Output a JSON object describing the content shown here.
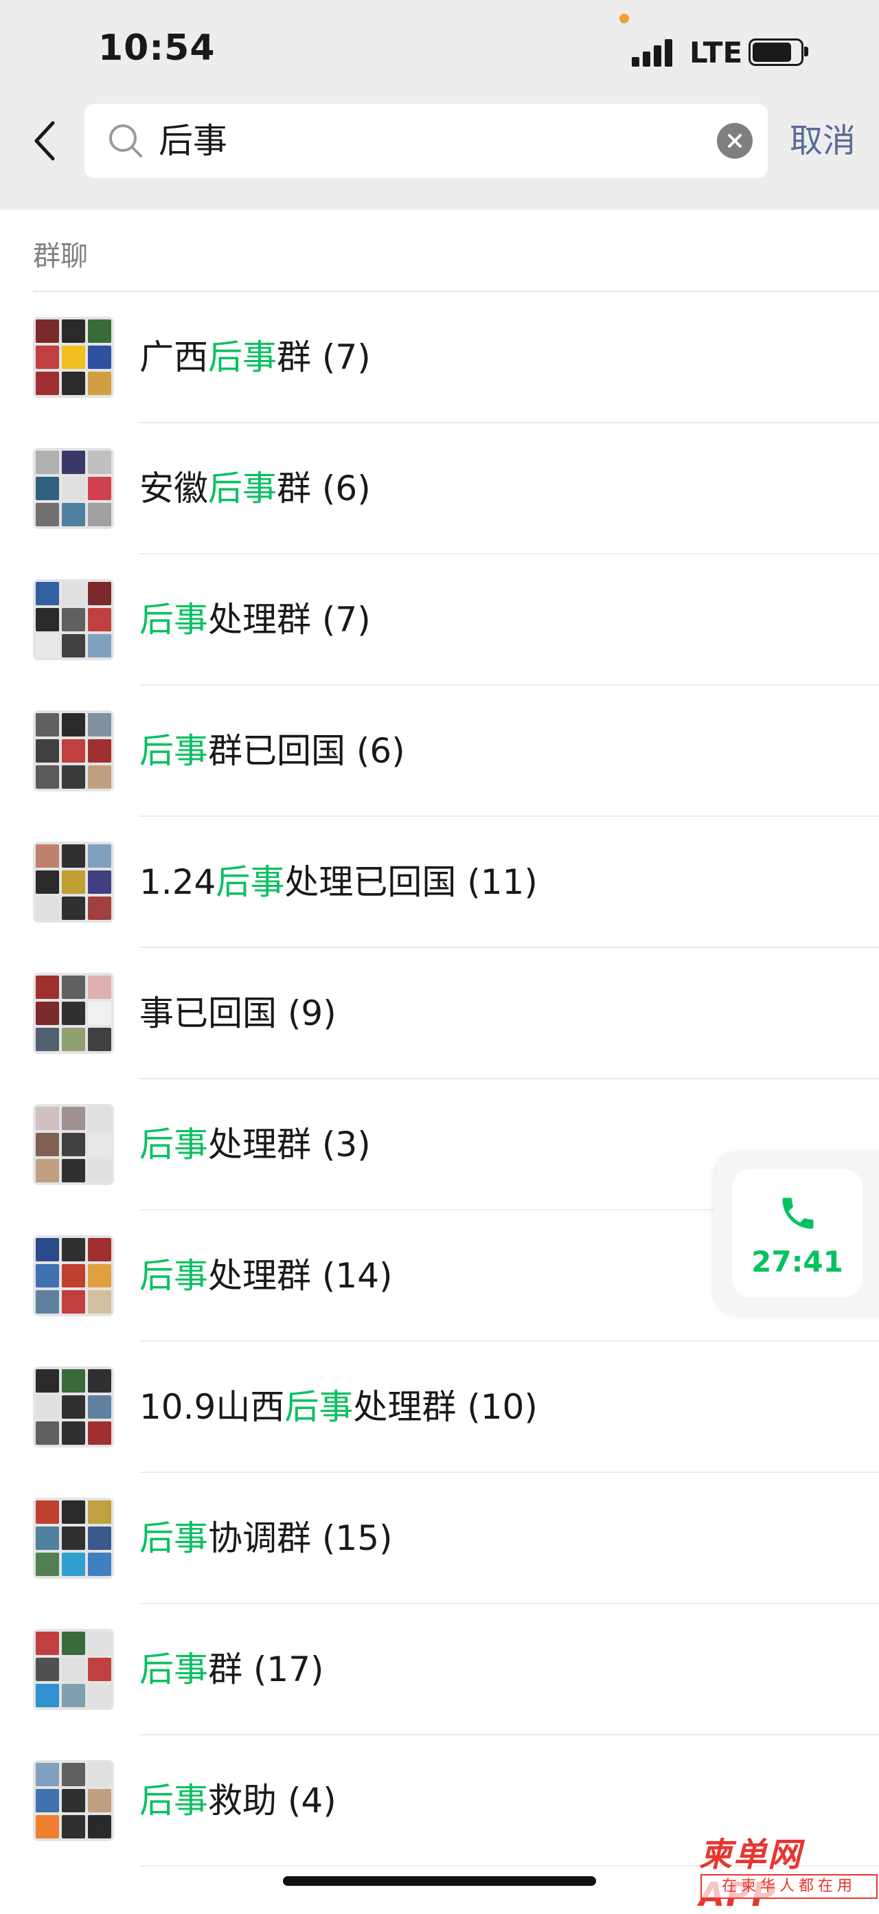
{
  "status_bar": {
    "time": "10:54",
    "network": "LTE"
  },
  "search": {
    "value": "后事",
    "cancel_label": "取消"
  },
  "section": {
    "title": "群聊"
  },
  "groups": [
    {
      "prefix": "广西",
      "highlight": "后事",
      "suffix": "群",
      "count": " (7)"
    },
    {
      "prefix": "安徽",
      "highlight": "后事",
      "suffix": "群",
      "count": " (6)"
    },
    {
      "prefix": "",
      "highlight": "后事",
      "suffix": "处理群",
      "count": " (7)"
    },
    {
      "prefix": "",
      "highlight": "后事",
      "suffix": "群已回国",
      "count": " (6)"
    },
    {
      "prefix": "1.24",
      "highlight": "后事",
      "suffix": "处理已回国",
      "count": " (11)"
    },
    {
      "prefix": "",
      "highlight": "",
      "suffix": "事已回国",
      "count": " (9)"
    },
    {
      "prefix": "",
      "highlight": "后事",
      "suffix": "处理群",
      "count": " (3)"
    },
    {
      "prefix": "",
      "highlight": "后事",
      "suffix": "处理群",
      "count": " (14)"
    },
    {
      "prefix": "10.9山西",
      "highlight": "后事",
      "suffix": "处理群",
      "count": " (10)"
    },
    {
      "prefix": "",
      "highlight": "后事",
      "suffix": "协调群",
      "count": " (15)"
    },
    {
      "prefix": "",
      "highlight": "后事",
      "suffix": "群",
      "count": " (17)"
    },
    {
      "prefix": "",
      "highlight": "后事",
      "suffix": "救助",
      "count": " (4)"
    }
  ],
  "call": {
    "duration": "27:41"
  },
  "watermark": {
    "brand": "柬单网APP",
    "tagline": "在柬华人都在用"
  },
  "colors": {
    "highlight": "#07c160",
    "link": "#576b95",
    "header_bg": "#ededed"
  }
}
